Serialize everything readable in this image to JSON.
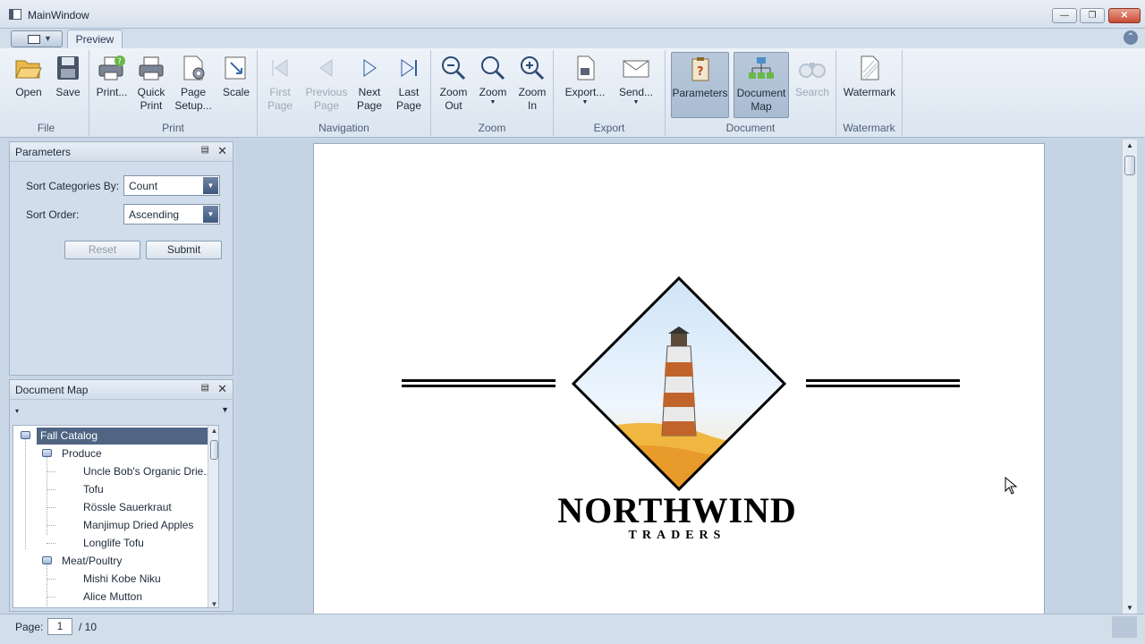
{
  "window": {
    "title": "MainWindow"
  },
  "ribbon": {
    "tab": "Preview",
    "groups": {
      "file": "File",
      "print": "Print",
      "navigation": "Navigation",
      "zoom": "Zoom",
      "export": "Export",
      "document": "Document",
      "watermark": "Watermark"
    },
    "buttons": {
      "open": "Open",
      "save": "Save",
      "print": "Print...",
      "quick_print": "Quick\nPrint",
      "page_setup": "Page\nSetup...",
      "scale": "Scale",
      "first_page": "First\nPage",
      "previous_page": "Previous\nPage",
      "next_page": "Next\nPage",
      "last_page": "Last\nPage",
      "zoom_out": "Zoom\nOut",
      "zoom": "Zoom",
      "zoom_in": "Zoom\nIn",
      "export": "Export...",
      "send": "Send...",
      "parameters": "Parameters",
      "document_map": "Document\nMap",
      "search": "Search",
      "watermark": "Watermark"
    }
  },
  "parameters_panel": {
    "title": "Parameters",
    "sort_categories_label": "Sort Categories By:",
    "sort_categories_value": "Count",
    "sort_order_label": "Sort Order:",
    "sort_order_value": "Ascending",
    "reset": "Reset",
    "submit": "Submit"
  },
  "document_map_panel": {
    "title": "Document Map",
    "root": "Fall Catalog",
    "categories": [
      {
        "label": "Produce",
        "items": [
          "Uncle Bob's Organic Drie...",
          "Tofu",
          "Rössle Sauerkraut",
          "Manjimup Dried Apples",
          "Longlife Tofu"
        ]
      },
      {
        "label": "Meat/Poultry",
        "items": [
          "Mishi Kobe Niku",
          "Alice Mutton"
        ]
      }
    ]
  },
  "report": {
    "logo_big": "NORTHWIND",
    "logo_small": "TRADERS"
  },
  "status": {
    "page_label": "Page:",
    "page_current": "1",
    "page_total": "/ 10"
  }
}
